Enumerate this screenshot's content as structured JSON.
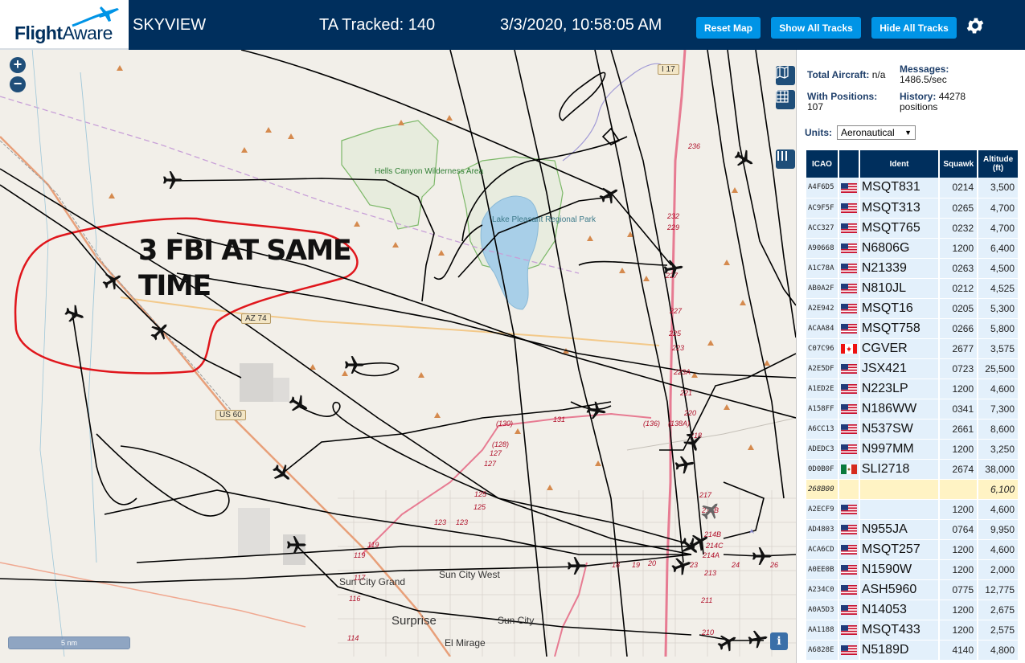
{
  "header": {
    "logo_flight": "Flight",
    "logo_aware": "Aware",
    "app_name": "SKYVIEW",
    "ta_tracked": "TA Tracked: 140",
    "datetime": "3/3/2020, 10:58:05 AM",
    "reset_map": "Reset Map",
    "show_all_tracks": "Show All Tracks",
    "hide_all_tracks": "Hide All Tracks"
  },
  "map": {
    "zoom_in": "+",
    "zoom_out": "−",
    "scale_label": "5 nm",
    "info": "i",
    "annotation_line1": "3 FBI AT SAME",
    "annotation_line2": "TIME",
    "park_name": "Hells Canyon Wilderness Area",
    "lake_name": "Lake Pleasant Regional Park",
    "shields": [
      "I 17",
      "AZ 74",
      "US 60"
    ],
    "cities": [
      "Sun City Grand",
      "Sun City West",
      "Surprise",
      "Sun City",
      "El Mirage"
    ],
    "route_labels": [
      "236",
      "232",
      "229",
      "227",
      "227",
      "225",
      "223",
      "223A",
      "221",
      "220",
      "218",
      "217",
      "215B",
      "214B",
      "214C",
      "214A",
      "213",
      "211",
      "210",
      "(130)",
      "131",
      "(128)",
      "127",
      "127",
      "125",
      "125",
      "123",
      "123",
      "(136)",
      "(138A)",
      "119",
      "119",
      "117",
      "116",
      "114",
      "18",
      "19",
      "20",
      "23",
      "24",
      "26"
    ]
  },
  "panel": {
    "total_aircraft_label": "Total Aircraft:",
    "total_aircraft_value": "n/a",
    "messages_label": "Messages:",
    "messages_value": "1486.5/sec",
    "with_positions_label": "With Positions:",
    "with_positions_value": "107",
    "history_label": "History:",
    "history_value": "44278",
    "history_unit": "positions",
    "units_label": "Units:",
    "units_value": "Aeronautical",
    "columns": [
      "ICAO",
      "",
      "Ident",
      "Squawk",
      "Altitude (ft)"
    ],
    "rows": [
      {
        "icao": "A4F6D5",
        "flag": "us",
        "ident": "MSQT831",
        "squawk": "0214",
        "alt": "3,500"
      },
      {
        "icao": "AC9F5F",
        "flag": "us",
        "ident": "MSQT313",
        "squawk": "0265",
        "alt": "4,700"
      },
      {
        "icao": "ACC327",
        "flag": "us",
        "ident": "MSQT765",
        "squawk": "0232",
        "alt": "4,700"
      },
      {
        "icao": "A90668",
        "flag": "us",
        "ident": "N6806G",
        "squawk": "1200",
        "alt": "6,400"
      },
      {
        "icao": "A1C78A",
        "flag": "us",
        "ident": "N21339",
        "squawk": "0263",
        "alt": "4,500"
      },
      {
        "icao": "AB0A2F",
        "flag": "us",
        "ident": "N810JL",
        "squawk": "0212",
        "alt": "4,525"
      },
      {
        "icao": "A2E942",
        "flag": "us",
        "ident": "MSQT16",
        "squawk": "0205",
        "alt": "5,300"
      },
      {
        "icao": "ACAA84",
        "flag": "us",
        "ident": "MSQT758",
        "squawk": "0266",
        "alt": "5,800"
      },
      {
        "icao": "C07C96",
        "flag": "ca",
        "ident": "CGVER",
        "squawk": "2677",
        "alt": "3,575"
      },
      {
        "icao": "A2E5DF",
        "flag": "us",
        "ident": "JSX421",
        "squawk": "0723",
        "alt": "25,500"
      },
      {
        "icao": "A1ED2E",
        "flag": "us",
        "ident": "N223LP",
        "squawk": "1200",
        "alt": "4,600"
      },
      {
        "icao": "A158FF",
        "flag": "us",
        "ident": "N186WW",
        "squawk": "0341",
        "alt": "7,300"
      },
      {
        "icao": "A6CC13",
        "flag": "us",
        "ident": "N537SW",
        "squawk": "2661",
        "alt": "8,600"
      },
      {
        "icao": "ADEDC3",
        "flag": "us",
        "ident": "N997MM",
        "squawk": "1200",
        "alt": "3,250"
      },
      {
        "icao": "0D0B0F",
        "flag": "mx",
        "ident": "SLI2718",
        "squawk": "2674",
        "alt": "38,000"
      },
      {
        "icao": "268B00",
        "flag": "",
        "ident": "",
        "squawk": "",
        "alt": "6,100",
        "selected": true
      },
      {
        "icao": "A2ECF9",
        "flag": "us",
        "ident": "",
        "squawk": "1200",
        "alt": "4,600"
      },
      {
        "icao": "AD4803",
        "flag": "us",
        "ident": "N955JA",
        "squawk": "0764",
        "alt": "9,950"
      },
      {
        "icao": "ACA6CD",
        "flag": "us",
        "ident": "MSQT257",
        "squawk": "1200",
        "alt": "4,600"
      },
      {
        "icao": "A0EE0B",
        "flag": "us",
        "ident": "N1590W",
        "squawk": "1200",
        "alt": "2,000"
      },
      {
        "icao": "A234C0",
        "flag": "us",
        "ident": "ASH5960",
        "squawk": "0775",
        "alt": "12,775"
      },
      {
        "icao": "A0A5D3",
        "flag": "us",
        "ident": "N14053",
        "squawk": "1200",
        "alt": "2,675"
      },
      {
        "icao": "AA1188",
        "flag": "us",
        "ident": "MSQT433",
        "squawk": "1200",
        "alt": "2,575"
      },
      {
        "icao": "A6828E",
        "flag": "us",
        "ident": "N5189D",
        "squawk": "4140",
        "alt": "4,800"
      }
    ]
  },
  "colors": {
    "header_bg": "#002f5d",
    "button_bg": "#0094e6",
    "row_bg": "#e3f0fb",
    "selected_row_bg": "#fff3c4",
    "annotation_red": "#e0161c",
    "track_black": "#000000"
  },
  "icons": {
    "gear": "gear-icon",
    "map_layers": "map-icon",
    "grid": "grid-icon",
    "columns": "columns-icon",
    "plane": "airplane-icon"
  }
}
